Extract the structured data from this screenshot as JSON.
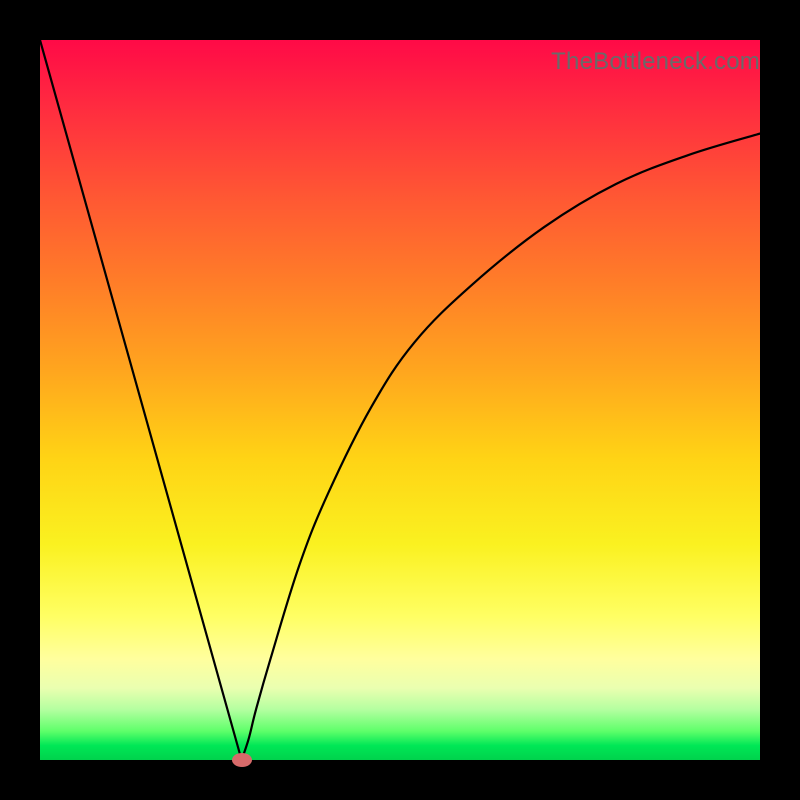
{
  "watermark": "TheBottleneck.com",
  "chart_data": {
    "type": "line",
    "title": "",
    "xlabel": "",
    "ylabel": "",
    "xlim": [
      0,
      100
    ],
    "ylim": [
      0,
      100
    ],
    "grid": false,
    "legend": false,
    "curve_description": "V-shaped bottleneck curve: falls steeply from top-left, reaches minimum near x≈28, then rises asymptotically toward upper right",
    "series": [
      {
        "name": "bottleneck-curve",
        "color": "#000000",
        "x": [
          0,
          4,
          8,
          12,
          16,
          20,
          24,
          26,
          27,
          28,
          29,
          30,
          32,
          36,
          40,
          46,
          52,
          60,
          70,
          80,
          90,
          100
        ],
        "y": [
          100,
          86,
          71,
          57,
          43,
          29,
          14,
          7,
          3,
          0,
          3,
          7,
          14,
          27,
          37,
          49,
          58,
          66,
          74,
          80,
          84,
          87
        ]
      }
    ],
    "markers": [
      {
        "name": "optimal-point",
        "x": 28,
        "y": 0,
        "color": "#d76a6a"
      }
    ],
    "background_gradient": {
      "direction": "vertical",
      "stops": [
        {
          "pos": 0,
          "color": "#ff0a47"
        },
        {
          "pos": 50,
          "color": "#ffba1a"
        },
        {
          "pos": 75,
          "color": "#faf120"
        },
        {
          "pos": 100,
          "color": "#00d24c"
        }
      ]
    }
  }
}
